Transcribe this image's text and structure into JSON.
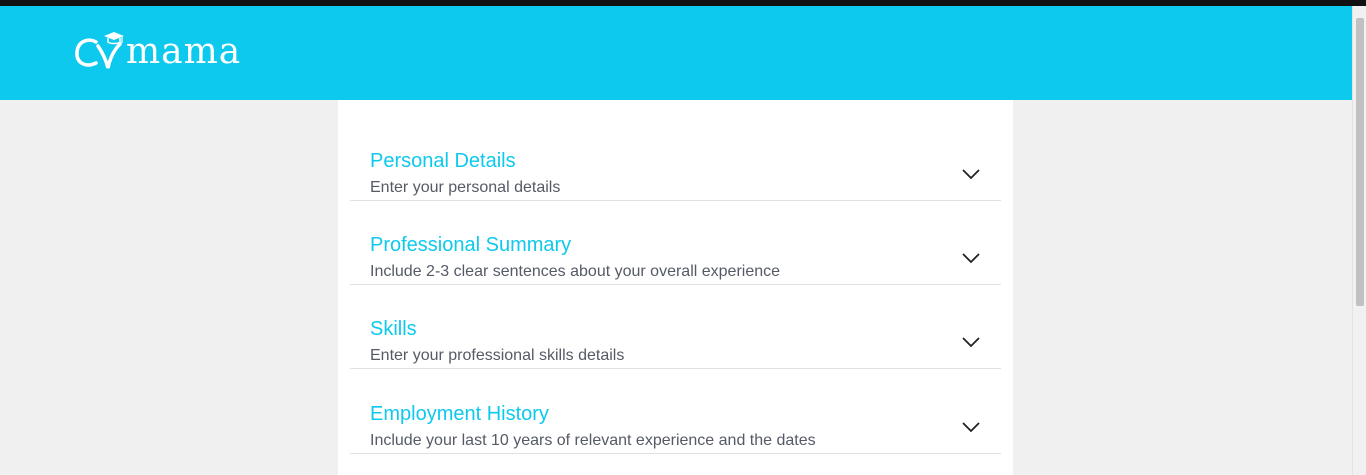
{
  "app": {
    "logo_text": "CVmama",
    "logo_icon": "graduate-cap-logo-icon"
  },
  "colors": {
    "accent": "#0ec9ee",
    "background": "#f0f0f0",
    "card": "#ffffff",
    "subtitle": "#555a66",
    "divider": "#e1e1e1"
  },
  "sections": [
    {
      "title": "Personal Details",
      "subtitle": "Enter your personal details",
      "icon": "chevron-down-icon"
    },
    {
      "title": "Professional Summary",
      "subtitle": "Include 2-3 clear sentences about your overall experience",
      "icon": "chevron-down-icon"
    },
    {
      "title": "Skills",
      "subtitle": "Enter your professional skills details",
      "icon": "chevron-down-icon"
    },
    {
      "title": "Employment History",
      "subtitle": "Include your last 10 years of relevant experience and the dates",
      "icon": "chevron-down-icon"
    }
  ]
}
